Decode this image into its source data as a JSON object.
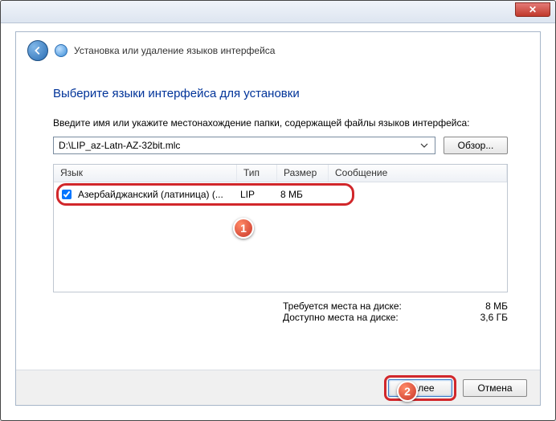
{
  "titlebar": {
    "close": "✕"
  },
  "header": {
    "title": "Установка или удаление языков интерфейса"
  },
  "main": {
    "heading": "Выберите языки интерфейса для установки",
    "instruction": "Введите имя или укажите местонахождение папки, содержащей файлы языков интерфейса:",
    "path": "D:\\LIP_az-Latn-AZ-32bit.mlc",
    "browse": "Обзор..."
  },
  "table": {
    "cols": {
      "c1": "Язык",
      "c2": "Тип",
      "c3": "Размер",
      "c4": "Сообщение"
    },
    "rows": [
      {
        "checked": true,
        "lang": "Азербайджанский (латиница) (...",
        "type": "LIP",
        "size": "8 МБ",
        "msg": ""
      }
    ]
  },
  "disk": {
    "req_lbl": "Требуется места на диске:",
    "req_val": "8 МБ",
    "avail_lbl": "Доступно места на диске:",
    "avail_val": "3,6 ГБ"
  },
  "footer": {
    "next": "Далее",
    "cancel": "Отмена"
  },
  "markers": {
    "m1": "1",
    "m2": "2"
  }
}
